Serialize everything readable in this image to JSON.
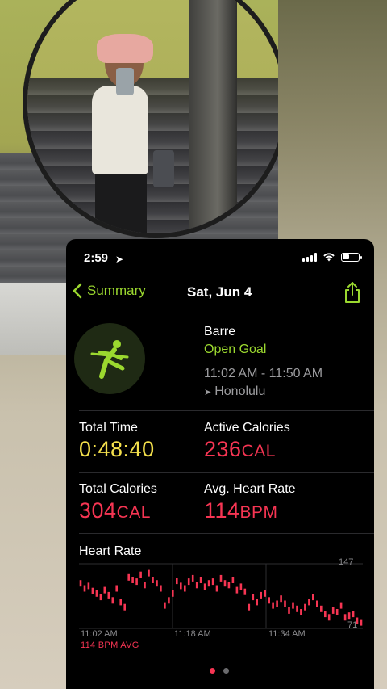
{
  "status_bar": {
    "time": "2:59"
  },
  "nav": {
    "back_label": "Summary",
    "date": "Sat, Jun 4"
  },
  "workout": {
    "name": "Barre",
    "goal": "Open Goal",
    "time_range": "11:02 AM - 11:50 AM",
    "location": "Honolulu"
  },
  "metrics": {
    "total_time": {
      "label": "Total Time",
      "value": "0:48:40"
    },
    "active_calories": {
      "label": "Active Calories",
      "value": "236",
      "unit": "CAL"
    },
    "total_calories": {
      "label": "Total Calories",
      "value": "304",
      "unit": "CAL"
    },
    "avg_heart_rate": {
      "label": "Avg. Heart Rate",
      "value": "114",
      "unit": "BPM"
    }
  },
  "heart_rate": {
    "title": "Heart Rate",
    "y_max_label": "147",
    "y_min_label": "71",
    "x_labels": [
      "11:02 AM",
      "11:18 AM",
      "11:34 AM"
    ],
    "avg_label": "114 BPM AVG"
  },
  "colors": {
    "accent_green": "#9bd82f",
    "yellow": "#f4e04c",
    "pink": "#f63553"
  },
  "chart_data": {
    "type": "scatter",
    "title": "Heart Rate",
    "xlabel": "",
    "ylabel": "",
    "ylim": [
      71,
      147
    ],
    "x_ticks": [
      "11:02 AM",
      "11:18 AM",
      "11:34 AM"
    ],
    "y_ticks": [
      147,
      71
    ],
    "series": [
      {
        "values": [
          124,
          118,
          121,
          115,
          112,
          108,
          116,
          110,
          104,
          118,
          102,
          96,
          131,
          128,
          126,
          134,
          122,
          136,
          128,
          124,
          118,
          98,
          104,
          112,
          127,
          121,
          118,
          126,
          130,
          122,
          128,
          120,
          124,
          126,
          118,
          130,
          124,
          122,
          128,
          116,
          120,
          114,
          96,
          108,
          102,
          110,
          112,
          104,
          98,
          100,
          106,
          100,
          92,
          98,
          94,
          90,
          96,
          102,
          108,
          100,
          94,
          88,
          84,
          92,
          90,
          98,
          84,
          86,
          88,
          80,
          78
        ]
      }
    ]
  }
}
